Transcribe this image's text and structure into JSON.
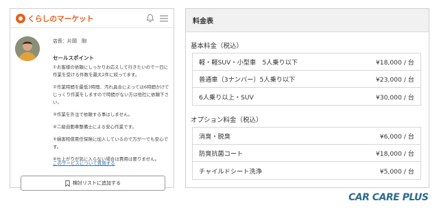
{
  "left": {
    "logo": "くらしのマーケット",
    "store_manager": "店長：片岡　剛",
    "sales_title": "セールスポイント",
    "sales_points": [
      "①お客様の依頼にしっかりお応えして行きたいので一日に作業を受ける件数を最大2件に絞ってます。",
      "②作業時間を最低3時間、汚れ具合によっては6時間かけてじっくり作業をしますので時間がない方は他社に依頼下さい。",
      "③作業を外注で依頼する事はしません。",
      "④二級自動車整備士による安心作業です。",
      "⑤損害賠償責任保険に加入しているので万が一でも安心です。",
      "⑥仕上がりが気に入らない場合は費用は要りません。"
    ],
    "question_link": "このサービスについて質問する",
    "add_button": "検討リストに追加する"
  },
  "right": {
    "title": "料金表",
    "basic_title": "基本料金（税込）",
    "basic_rows": [
      {
        "name": "軽・軽SUV・小型車　5人乗り以下",
        "price": "¥18,000 / 台"
      },
      {
        "name": "普通車（3ナンバー）5人乗り以下",
        "price": "¥23,000 / 台"
      },
      {
        "name": "6人乗り以上・SUV",
        "price": "¥30,000 / 台"
      }
    ],
    "option_title": "オプション料金（税込）",
    "option_rows": [
      {
        "name": "消臭・脱臭",
        "price": "¥6,000 / 台"
      },
      {
        "name": "防臭抗菌コート",
        "price": "¥18,000 / 台"
      },
      {
        "name": "チャイルドシート洗浄",
        "price": "¥5,000 / 台"
      }
    ]
  },
  "brand": "CAR CARE PLUS",
  "colors": {
    "logo_orange": "#e8601c",
    "link_blue": "#1e73be",
    "brand_blue": "#2b6b8f"
  },
  "icons": {
    "logo": "kurashi-logo-icon",
    "bell": "bell-icon",
    "menu": "hamburger-menu-icon",
    "bookmark": "bookmark-icon"
  }
}
